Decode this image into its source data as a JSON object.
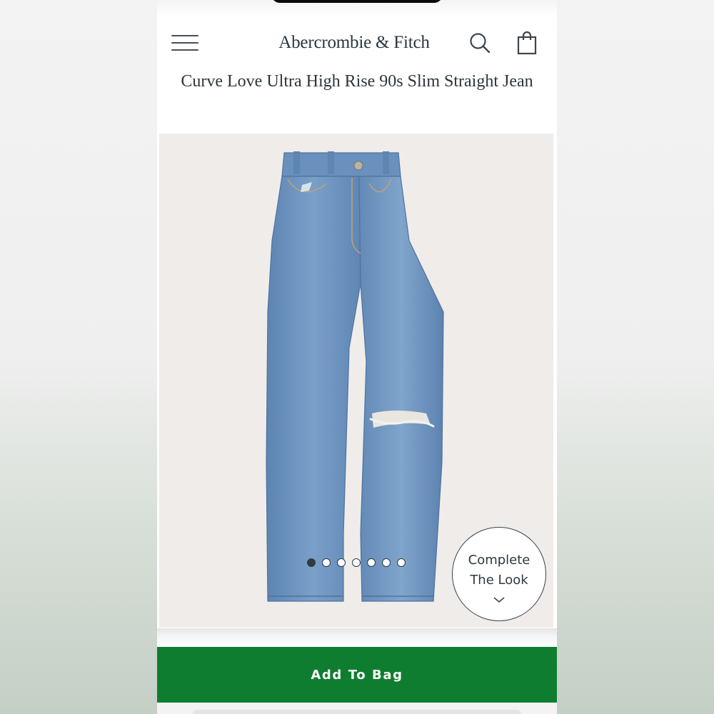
{
  "header": {
    "brand": "Abercrombie & Fitch",
    "menu_icon": "hamburger-menu-icon",
    "search_icon": "search-icon",
    "bag_icon": "shopping-bag-icon"
  },
  "product": {
    "title": "Curve Love Ultra High Rise 90s Slim Straight Jean",
    "image_description_icon": "jeans-product-image"
  },
  "carousel": {
    "total_images": 7,
    "active_index": 1
  },
  "complete_look": {
    "line1": "Complete",
    "line2": "The Look",
    "icon": "chevron-down-icon"
  },
  "actions": {
    "add_to_bag": "Add To Bag"
  },
  "colors": {
    "add_to_bag_bg": "#0f7d2f",
    "text_dark": "#2c353d",
    "denim": "#6e93bf"
  }
}
